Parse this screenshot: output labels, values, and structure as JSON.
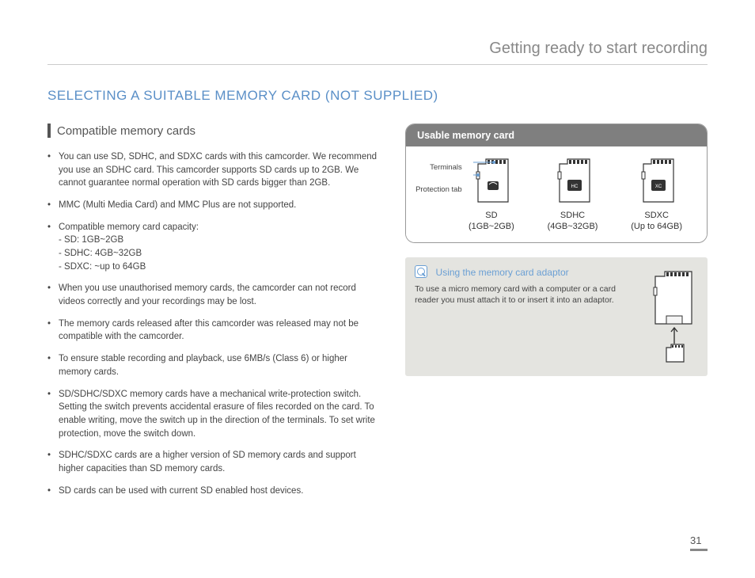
{
  "chapter": "Getting ready to start recording",
  "heading": "SELECTING A SUITABLE MEMORY CARD (NOT SUPPLIED)",
  "subheading": "Compatible memory cards",
  "bullets": [
    {
      "text": "You can use SD, SDHC, and SDXC cards with this camcorder. We recommend you use an SDHC card. This camcorder supports SD cards up to 2GB. We cannot guarantee normal operation with SD cards bigger than 2GB."
    },
    {
      "text": "MMC (Multi Media Card) and MMC Plus are not supported."
    },
    {
      "text": "Compatible memory card capacity:",
      "sub": [
        "- SD: 1GB~2GB",
        "- SDHC: 4GB~32GB",
        "- SDXC: ~up to 64GB"
      ]
    },
    {
      "text": "When you use unauthorised memory cards, the camcorder can not record videos correctly and your recordings may be lost."
    },
    {
      "text": "The memory cards released after this camcorder was released may not be compatible with the camcorder."
    },
    {
      "text": "To ensure stable recording and playback, use 6MB/s (Class 6) or higher memory cards."
    },
    {
      "text": "SD/SDHC/SDXC memory cards have a mechanical write-protection switch. Setting the switch prevents accidental erasure of files recorded on the card. To enable writing, move the switch up in the direction of the terminals. To set write protection, move the switch down."
    },
    {
      "text": "SDHC/SDXC cards are a higher version of SD memory cards and support higher capacities than SD memory cards."
    },
    {
      "text": "SD cards can be used with current SD enabled host devices."
    }
  ],
  "panel": {
    "title": "Usable memory card",
    "pointers": {
      "terminals": "Terminals",
      "protection": "Protection tab"
    },
    "cards": [
      {
        "name": "SD",
        "cap": "(1GB~2GB)"
      },
      {
        "name": "SDHC",
        "cap": "(4GB~32GB)"
      },
      {
        "name": "SDXC",
        "cap": "(Up to 64GB)"
      }
    ]
  },
  "info": {
    "title": "Using the memory card adaptor",
    "text": "To use a micro memory card with a computer or a card reader you must attach it to or insert it into an adaptor."
  },
  "page_number": "31"
}
